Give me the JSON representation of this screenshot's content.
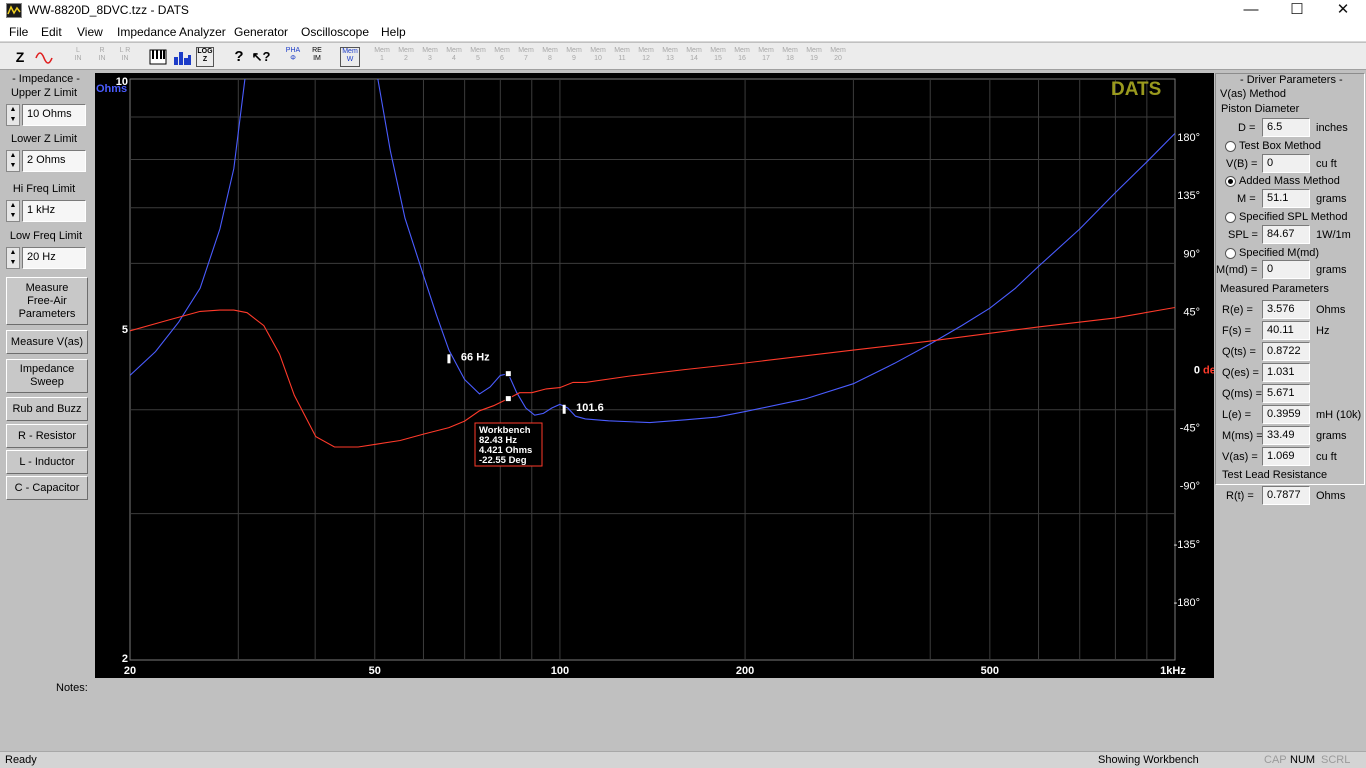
{
  "window": {
    "title": "WW-8820D_8DVC.tzz - DATS",
    "minimize": "—",
    "maximize": "☐",
    "close": "✕"
  },
  "menu": [
    "File",
    "Edit",
    "View",
    "Impedance Analyzer",
    "Generator",
    "Oscilloscope",
    "Help"
  ],
  "toolbar": {
    "z_label": "Z",
    "l_in": "L\nIN",
    "r_in": "R\nIN",
    "lr_in": "L R\nIN",
    "log_z": "LOG\nZ",
    "pha": "PHA\nΦ",
    "re_im": "RE\nIM",
    "mem_w": "Mem\nW",
    "mems": [
      "1",
      "2",
      "3",
      "4",
      "5",
      "6",
      "7",
      "8",
      "9",
      "10",
      "11",
      "12",
      "13",
      "14",
      "15",
      "16",
      "17",
      "18",
      "19",
      "20"
    ],
    "mem_prefix": "Mem"
  },
  "left_panel": {
    "impedance_title": "- Impedance -",
    "upper_z_title": "Upper Z Limit",
    "upper_z_value": "10 Ohms",
    "lower_z_title": "Lower Z Limit",
    "lower_z_value": "2 Ohms",
    "hi_freq_title": "Hi Freq Limit",
    "hi_freq_value": "1 kHz",
    "low_freq_title": "Low Freq Limit",
    "low_freq_value": "20 Hz",
    "buttons": [
      "Measure\nFree-Air\nParameters",
      "Measure V(as)",
      "Impedance\nSweep",
      "Rub and Buzz",
      "R - Resistor",
      "L - Inductor",
      "C - Capacitor"
    ],
    "notes_label": "Notes:"
  },
  "plot": {
    "brand": "DATS",
    "y_unit_left": "Ohms",
    "y_unit_right": "deg",
    "y_ticks_left": [
      {
        "value": 10,
        "label": "10"
      },
      {
        "value": 5,
        "label": "5"
      },
      {
        "value": 2,
        "label": "2"
      }
    ],
    "y_ticks_right": [
      {
        "value": 180,
        "label": "180°"
      },
      {
        "value": 135,
        "label": "135°"
      },
      {
        "value": 90,
        "label": "90°"
      },
      {
        "value": 45,
        "label": "45°"
      },
      {
        "value": 0,
        "label": "0"
      },
      {
        "value": -45,
        "label": "-45°"
      },
      {
        "value": -90,
        "label": "-90°"
      },
      {
        "value": -135,
        "label": "-135°"
      },
      {
        "value": -180,
        "label": "-180°"
      }
    ],
    "x_ticks": [
      {
        "value": 20,
        "label": "20"
      },
      {
        "value": 50,
        "label": "50"
      },
      {
        "value": 100,
        "label": "100"
      },
      {
        "value": 200,
        "label": "200"
      },
      {
        "value": 500,
        "label": "500"
      },
      {
        "value": 1000,
        "label": "1kHz"
      }
    ],
    "markers": [
      {
        "freq": 66,
        "ohms": 4.6,
        "label": "66 Hz"
      },
      {
        "freq": 101.6,
        "ohms": 4.0,
        "label": "101.6"
      }
    ],
    "cursor": {
      "freq": 82.43,
      "ohms": 4.421,
      "deg": -22.55,
      "lines": [
        "Workbench",
        "82.43 Hz",
        "4.421 Ohms",
        "-22.55 Deg"
      ]
    },
    "colors": {
      "impedance": "#4a5cff",
      "phase": "#ff3a2a",
      "brand": "#9a9a1e",
      "grid": "#3c3c3c"
    }
  },
  "chart_data": {
    "type": "line",
    "title": "",
    "xlabel": "",
    "ylabel": "Ohms",
    "y2label": "deg",
    "xscale": "log",
    "yscale": "log",
    "xlim": [
      20,
      1000
    ],
    "ylim": [
      2,
      10
    ],
    "y2lim": [
      -225,
      225
    ],
    "grid": true,
    "series": [
      {
        "axis": "ohms",
        "x": [
          20,
          22,
          24,
          26,
          28,
          29.5,
          31,
          33,
          35,
          37,
          38.5,
          40.1,
          42,
          44,
          47,
          50,
          53,
          56,
          60,
          63,
          66,
          70,
          74,
          77,
          80,
          82.4,
          85,
          88,
          91,
          94,
          97,
          100,
          103,
          106,
          110,
          120,
          140,
          160,
          180,
          200,
          250,
          300,
          350,
          400,
          450,
          500,
          550,
          600,
          700,
          800,
          900,
          1000
        ],
        "y": [
          4.4,
          4.7,
          5.1,
          5.6,
          6.6,
          7.8,
          10.5,
          16,
          24,
          32,
          35.6,
          36,
          34,
          24,
          15,
          10.5,
          8.2,
          6.8,
          5.8,
          5.2,
          4.72,
          4.35,
          4.18,
          4.26,
          4.4,
          4.42,
          4.2,
          4.02,
          3.94,
          3.96,
          4.02,
          4.06,
          4.02,
          3.93,
          3.9,
          3.88,
          3.86,
          3.89,
          3.92,
          3.98,
          4.12,
          4.3,
          4.55,
          4.8,
          5.05,
          5.3,
          5.6,
          5.95,
          6.6,
          7.3,
          7.95,
          8.6
        ]
      },
      {
        "axis": "deg",
        "x": [
          20,
          23,
          26,
          28,
          29.5,
          31,
          33,
          35,
          37,
          40.1,
          43,
          47,
          50,
          55,
          60,
          66,
          70,
          74,
          78,
          82.4,
          86,
          90,
          95,
          100,
          105,
          110,
          130,
          160,
          200,
          300,
          400,
          500,
          600,
          800,
          1000
        ],
        "y": [
          30,
          38,
          45,
          46,
          46,
          44,
          34,
          12,
          -20,
          -52,
          -60,
          -60,
          -58,
          -55,
          -50,
          -45,
          -40,
          -32,
          -28,
          -22.55,
          -18,
          -18,
          -15,
          -14,
          -10,
          -10,
          -5,
          0,
          5,
          15,
          22,
          28,
          33,
          40,
          48
        ]
      }
    ]
  },
  "right_panel": {
    "driver_title": "- Driver Parameters -",
    "vas_method": "V(as) Method",
    "piston_diameter": "Piston Diameter",
    "d_label": "D =",
    "d_value": "6.5",
    "d_unit": "inches",
    "test_box": "Test Box Method",
    "vb_label": "V(B) =",
    "vb_value": "0",
    "vb_unit": "cu ft",
    "added_mass": "Added Mass Method",
    "m_label": "M =",
    "m_value": "51.1",
    "m_unit": "grams",
    "spl_method": "Specified SPL Method",
    "spl_label": "SPL =",
    "spl_value": "84.67",
    "spl_unit": "1W/1m",
    "mmd_method": "Specified M(md)",
    "mmd_label": "M(md) =",
    "mmd_value": "0",
    "mmd_unit": "grams",
    "measured_title": "Measured Parameters",
    "measured": [
      {
        "label": "R(e) =",
        "value": "3.576",
        "unit": "Ohms"
      },
      {
        "label": "F(s) =",
        "value": "40.11",
        "unit": "Hz"
      },
      {
        "label": "Q(ts) =",
        "value": "0.8722",
        "unit": ""
      },
      {
        "label": "Q(es) =",
        "value": "1.031",
        "unit": ""
      },
      {
        "label": "Q(ms) =",
        "value": "5.671",
        "unit": ""
      },
      {
        "label": "L(e) =",
        "value": "0.3959",
        "unit": "mH (10k)"
      },
      {
        "label": "M(ms) =",
        "value": "33.49",
        "unit": "grams"
      },
      {
        "label": "V(as) =",
        "value": "1.069",
        "unit": "cu ft"
      }
    ],
    "test_lead_title": "Test Lead Resistance",
    "rt_label": "R(t) =",
    "rt_value": "0.7877",
    "rt_unit": "Ohms"
  },
  "status": {
    "left": "Ready",
    "center": "Showing Workbench",
    "cap": "CAP",
    "num": "NUM",
    "scrl": "SCRL"
  }
}
